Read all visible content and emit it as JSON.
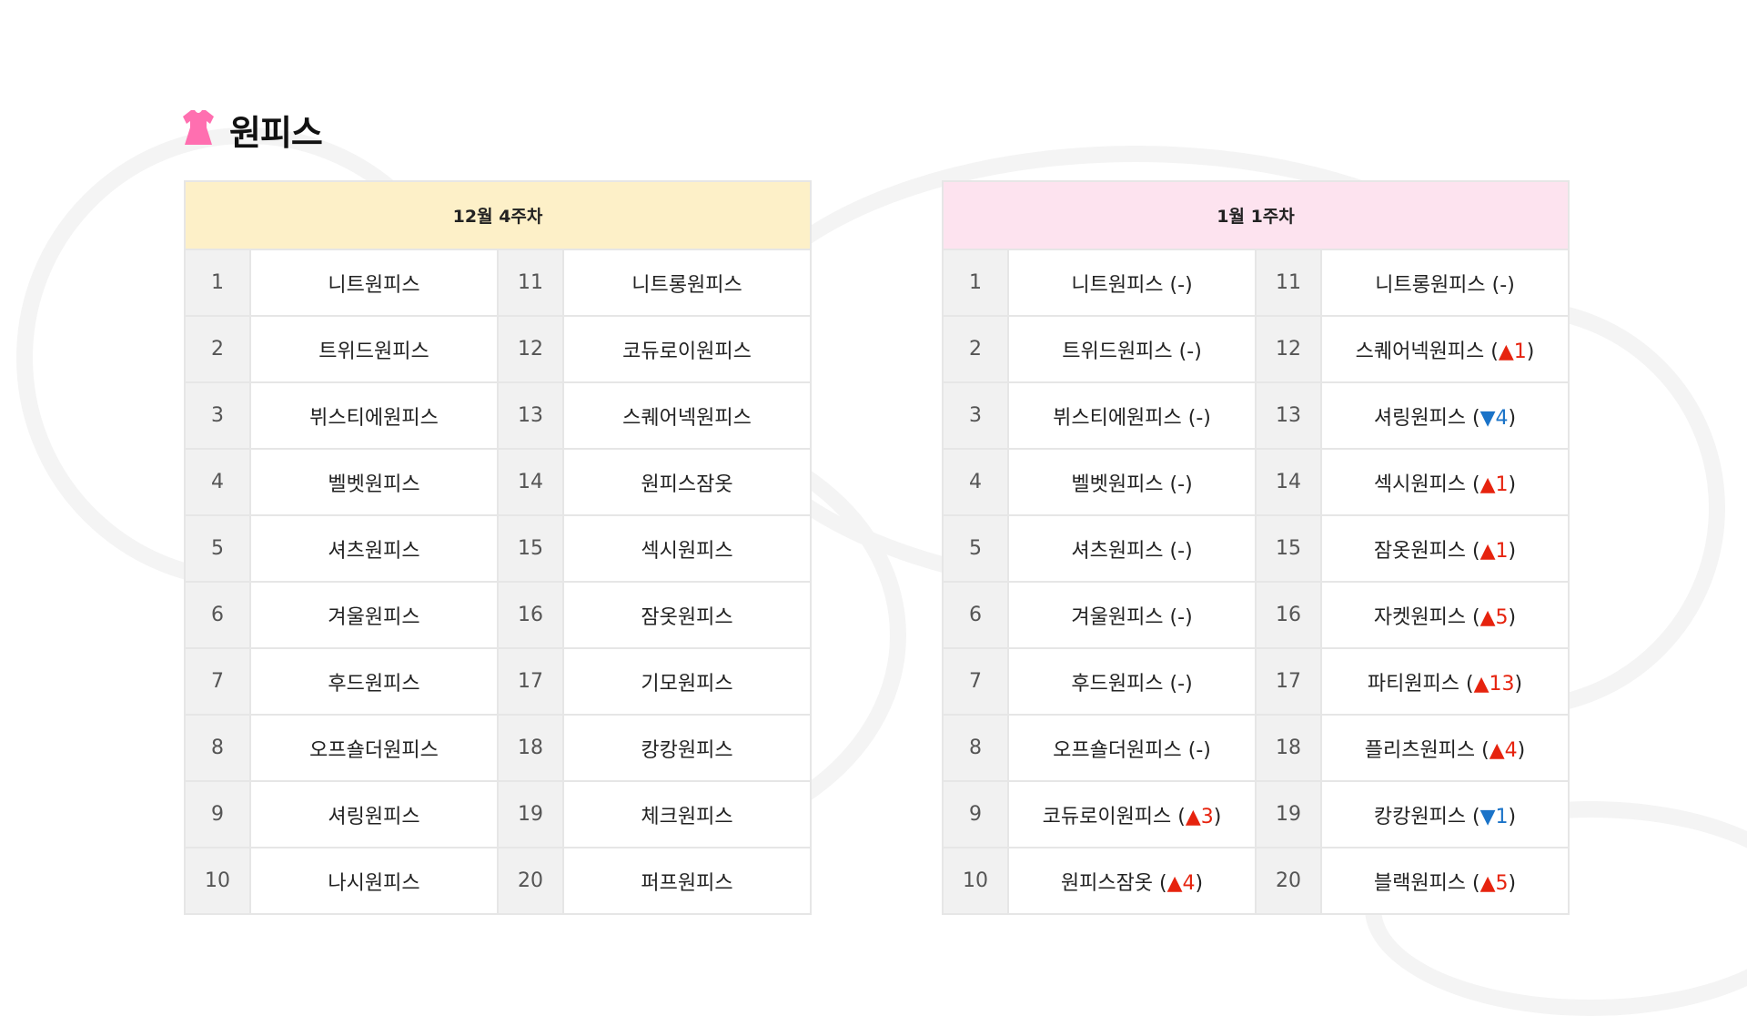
{
  "page_title": "원피스",
  "icon": "dress-icon",
  "colors": {
    "left_header_bg": "#fdf0c8",
    "right_header_bg": "#fde3ef",
    "icon_color": "#ff6fb0",
    "up": "#e6230e",
    "down": "#1a73c8"
  },
  "left_table": {
    "header": "12월 4주차",
    "rows": [
      {
        "rank_a": "1",
        "name_a": "니트원피스",
        "rank_b": "11",
        "name_b": "니트롱원피스"
      },
      {
        "rank_a": "2",
        "name_a": "트위드원피스",
        "rank_b": "12",
        "name_b": "코듀로이원피스"
      },
      {
        "rank_a": "3",
        "name_a": "뷔스티에원피스",
        "rank_b": "13",
        "name_b": "스퀘어넥원피스"
      },
      {
        "rank_a": "4",
        "name_a": "벨벳원피스",
        "rank_b": "14",
        "name_b": "원피스잠옷"
      },
      {
        "rank_a": "5",
        "name_a": "셔츠원피스",
        "rank_b": "15",
        "name_b": "섹시원피스"
      },
      {
        "rank_a": "6",
        "name_a": "겨울원피스",
        "rank_b": "16",
        "name_b": "잠옷원피스"
      },
      {
        "rank_a": "7",
        "name_a": "후드원피스",
        "rank_b": "17",
        "name_b": "기모원피스"
      },
      {
        "rank_a": "8",
        "name_a": "오프숄더원피스",
        "rank_b": "18",
        "name_b": "캉캉원피스"
      },
      {
        "rank_a": "9",
        "name_a": "셔링원피스",
        "rank_b": "19",
        "name_b": "체크원피스"
      },
      {
        "rank_a": "10",
        "name_a": "나시원피스",
        "rank_b": "20",
        "name_b": "퍼프원피스"
      }
    ]
  },
  "right_table": {
    "header": "1월 1주차",
    "rows": [
      {
        "rank_a": "1",
        "name_a": "니트원피스",
        "change_a": "(-)",
        "rank_b": "11",
        "name_b": "니트롱원피스",
        "change_b": "(-)"
      },
      {
        "rank_a": "2",
        "name_a": "트위드원피스",
        "change_a": "(-)",
        "rank_b": "12",
        "name_b": "스퀘어넥원피스",
        "dir_b": "up",
        "arrow_b": "▲",
        "delta_b": "1"
      },
      {
        "rank_a": "3",
        "name_a": "뷔스티에원피스",
        "change_a": "(-)",
        "rank_b": "13",
        "name_b": "셔링원피스",
        "dir_b": "down",
        "arrow_b": "▼",
        "delta_b": "4"
      },
      {
        "rank_a": "4",
        "name_a": "벨벳원피스",
        "change_a": "(-)",
        "rank_b": "14",
        "name_b": "섹시원피스",
        "dir_b": "up",
        "arrow_b": "▲",
        "delta_b": "1"
      },
      {
        "rank_a": "5",
        "name_a": "셔츠원피스",
        "change_a": "(-)",
        "rank_b": "15",
        "name_b": "잠옷원피스",
        "dir_b": "up",
        "arrow_b": "▲",
        "delta_b": "1"
      },
      {
        "rank_a": "6",
        "name_a": "겨울원피스",
        "change_a": "(-)",
        "rank_b": "16",
        "name_b": "자켓원피스",
        "dir_b": "up",
        "arrow_b": "▲",
        "delta_b": "5"
      },
      {
        "rank_a": "7",
        "name_a": "후드원피스",
        "change_a": "(-)",
        "rank_b": "17",
        "name_b": "파티원피스",
        "dir_b": "up",
        "arrow_b": "▲",
        "delta_b": "13"
      },
      {
        "rank_a": "8",
        "name_a": "오프숄더원피스",
        "change_a": "(-)",
        "rank_b": "18",
        "name_b": "플리츠원피스",
        "dir_b": "up",
        "arrow_b": "▲",
        "delta_b": "4"
      },
      {
        "rank_a": "9",
        "name_a": "코듀로이원피스",
        "dir_a": "up",
        "arrow_a": "▲",
        "delta_a": "3",
        "rank_b": "19",
        "name_b": "캉캉원피스",
        "dir_b": "down",
        "arrow_b": "▼",
        "delta_b": "1"
      },
      {
        "rank_a": "10",
        "name_a": "원피스잠옷",
        "dir_a": "up",
        "arrow_a": "▲",
        "delta_a": "4",
        "rank_b": "20",
        "name_b": "블랙원피스",
        "dir_b": "up",
        "arrow_b": "▲",
        "delta_b": "5"
      }
    ]
  }
}
